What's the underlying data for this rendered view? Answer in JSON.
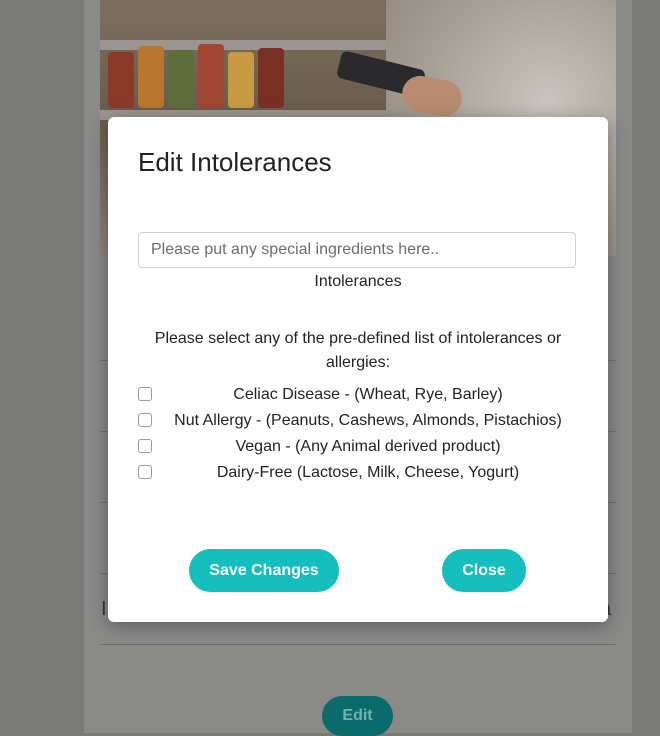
{
  "modal": {
    "title": "Edit Intolerances",
    "ingredients_placeholder": "Please put any special ingredients here..",
    "ingredients_value": "",
    "intolerances_label": "Intolerances",
    "instructions": "Please select any of the pre-defined list of intolerances or allergies:",
    "options": [
      {
        "label": "Celiac Disease - (Wheat, Rye, Barley)",
        "checked": false
      },
      {
        "label": "Nut Allergy - (Peanuts, Cashews, Almonds, Pistachios)",
        "checked": false
      },
      {
        "label": "Vegan - (Any Animal derived product)",
        "checked": false
      },
      {
        "label": "Dairy-Free (Lactose, Milk, Cheese, Yogurt)",
        "checked": false
      }
    ],
    "save_label": "Save Changes",
    "close_label": "Close"
  },
  "background": {
    "row_text_left": "I",
    "row_text_right": "a",
    "edit_label": "Edit"
  },
  "colors": {
    "accent": "#14bdbe",
    "overlay": "#7a7a78",
    "modal_bg": "#ffffff"
  }
}
